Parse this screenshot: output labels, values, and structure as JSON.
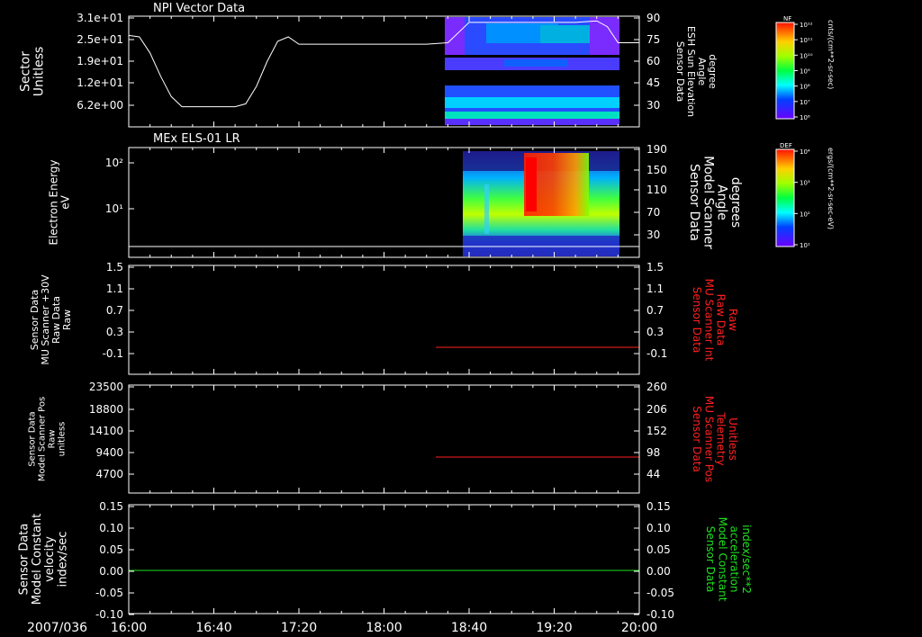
{
  "date_label": "2007/036",
  "x_ticks": [
    "16:00",
    "16:40",
    "17:20",
    "18:00",
    "18:40",
    "19:20",
    "20:00"
  ],
  "colors": {
    "white": "#ffffff",
    "red": "#ff2020",
    "green": "#20e020",
    "background": "#000000"
  },
  "panels": [
    {
      "title": "NPI Vector Data",
      "left_label": [
        "Sector",
        "Unitless"
      ],
      "left_ticks": [
        "3.1e+01",
        "2.5e+01",
        "1.9e+01",
        "1.2e+01",
        "6.2e+00"
      ],
      "right_label": [
        "Sensor Data",
        "ESH Sun Elevation",
        "Angle",
        "degree"
      ],
      "right_ticks": [
        "90",
        "75",
        "60",
        "45",
        "30"
      ],
      "colorbar": {
        "name": "NF",
        "ticks": [
          "10¹²",
          "10¹¹",
          "10¹⁰",
          "10⁹",
          "10⁸",
          "10⁷",
          "10⁶"
        ],
        "unit": "cnts/(cm**2-sr-sec)"
      }
    },
    {
      "title": "MEx ELS-01 LR",
      "left_label": [
        "Electron Energy",
        "eV"
      ],
      "left_ticks": [
        "10²",
        "10¹"
      ],
      "right_label": [
        "Sensor Data",
        "Model Scanner",
        "Angle",
        "degrees"
      ],
      "right_ticks": [
        "190",
        "150",
        "110",
        "70",
        "30"
      ],
      "colorbar": {
        "name": "DEF",
        "ticks": [
          "10⁴",
          "10³",
          "10²",
          "10¹"
        ],
        "unit": "ergs/(cm**2-sr-sec-eV)"
      }
    },
    {
      "left_label": [
        "Sensor Data",
        "MU Scanner +30V",
        "Raw Data",
        "Raw"
      ],
      "left_ticks": [
        "1.5",
        "1.1",
        "0.7",
        "0.3",
        "-0.1"
      ],
      "right_label": [
        "Sensor Data",
        "MU Scanner Int",
        "Raw Data",
        "Raw"
      ],
      "right_ticks": [
        "1.5",
        "1.1",
        "0.7",
        "0.3",
        "-0.1"
      ]
    },
    {
      "left_label": [
        "Sensor Data",
        "Model Scanner Pos",
        "Raw",
        "unitless"
      ],
      "left_ticks": [
        "23500",
        "18800",
        "14100",
        "9400",
        "4700"
      ],
      "right_label": [
        "Sensor Data",
        "MU Scanner Pos",
        "Telemetry",
        "Unitless"
      ],
      "right_ticks": [
        "260",
        "206",
        "152",
        "98",
        "44"
      ]
    },
    {
      "left_label": [
        "Sensor Data",
        "Model Constant",
        "velocity",
        "index/sec"
      ],
      "left_ticks": [
        "0.15",
        "0.10",
        "0.05",
        "0.00",
        "-0.05",
        "-0.10"
      ],
      "right_label": [
        "Sensor Data",
        "Model Constant",
        "acceleration",
        "index/sec**2"
      ],
      "right_ticks": [
        "0.15",
        "0.10",
        "0.05",
        "0.00",
        "-0.05",
        "-0.10"
      ]
    }
  ],
  "chart_data": [
    {
      "type": "line",
      "panel": "NPI Vector Data",
      "series": [
        {
          "name": "ESH Sun Elevation Angle",
          "x": [
            "16:00",
            "16:05",
            "16:10",
            "16:15",
            "16:20",
            "16:25",
            "16:40",
            "16:50",
            "16:55",
            "17:00",
            "17:05",
            "17:10",
            "17:15",
            "17:20",
            "17:30",
            "18:00",
            "18:20",
            "18:30",
            "18:35",
            "18:40",
            "19:00",
            "19:20",
            "19:30",
            "19:40",
            "19:45",
            "19:50",
            "20:00"
          ],
          "y": [
            78,
            77,
            66,
            50,
            36,
            29,
            29,
            29,
            31,
            43,
            60,
            74,
            77,
            72,
            72,
            72,
            72,
            73,
            80,
            87,
            87,
            87,
            87,
            88,
            84,
            73,
            73
          ]
        }
      ],
      "spectrogram": {
        "x_start": "18:30",
        "x_end": "19:57",
        "sector_range": [
          6.2,
          31
        ]
      }
    },
    {
      "type": "heatmap",
      "panel": "MEx ELS-01 LR",
      "x_start": "18:36",
      "x_end": "19:57",
      "series": [
        {
          "name": "Model Scanner Angle",
          "x": [
            "16:00",
            "20:00"
          ],
          "y": [
            12,
            12
          ]
        }
      ],
      "features": [
        {
          "time": "18:37",
          "energy_range_eV": [
            5,
            40
          ],
          "level": "green-yellow"
        },
        {
          "time": "19:00",
          "energy_range_eV": [
            10,
            150
          ],
          "level": "red-max"
        },
        {
          "time": "19:20",
          "energy_range_eV": [
            8,
            40
          ],
          "level": "yellow-orange"
        }
      ]
    },
    {
      "type": "line",
      "panel": "MU Scanner Int",
      "series": [
        {
          "name": "MU Scanner Int",
          "x": [
            "18:23",
            "20:00"
          ],
          "y": [
            0.0,
            0.0
          ]
        }
      ],
      "ylim": [
        -0.3,
        1.5
      ]
    },
    {
      "type": "line",
      "panel": "MU Scanner Pos Telemetry",
      "series": [
        {
          "name": "MU Scanner Pos Telemetry",
          "x": [
            "18:23",
            "20:00"
          ],
          "y": [
            84,
            84
          ]
        }
      ],
      "ylim": [
        0,
        260
      ]
    },
    {
      "type": "line",
      "panel": "Model Constant",
      "series": [
        {
          "name": "Model Constant velocity",
          "x": [
            "16:00",
            "20:00"
          ],
          "y": [
            0.0,
            0.0
          ]
        }
      ],
      "ylim": [
        -0.1,
        0.15
      ]
    }
  ]
}
